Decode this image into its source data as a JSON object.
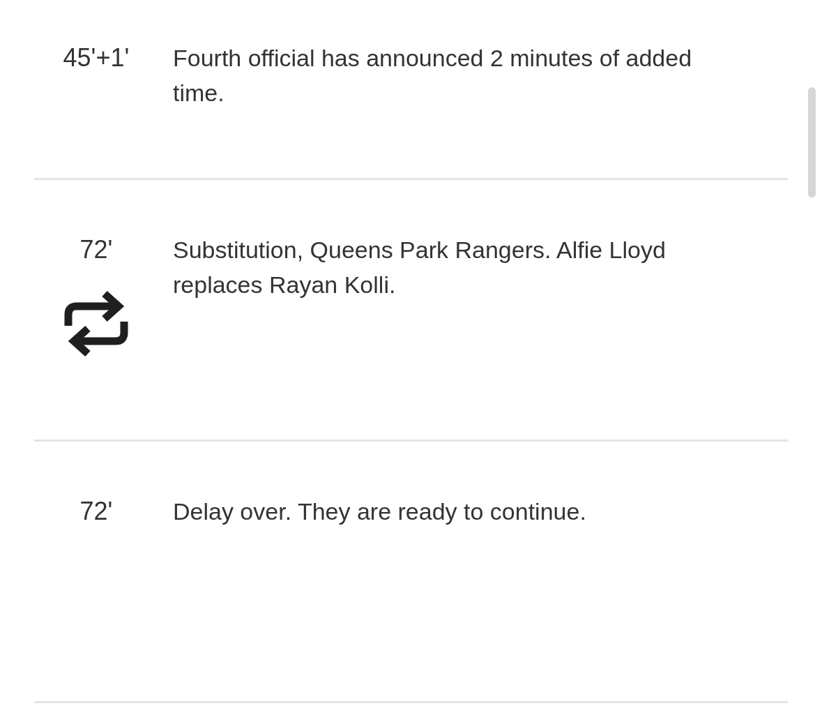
{
  "events": [
    {
      "kind": "note",
      "minute": "45'+1'",
      "text": "Fourth official has announced 2 minutes of added time."
    },
    {
      "kind": "substitution",
      "minute": "72'",
      "text": "Substitution, Queens Park Rangers. Alfie Lloyd replaces Rayan Kolli."
    },
    {
      "kind": "note",
      "minute": "72'",
      "text": "Delay over. They are ready to continue."
    }
  ]
}
